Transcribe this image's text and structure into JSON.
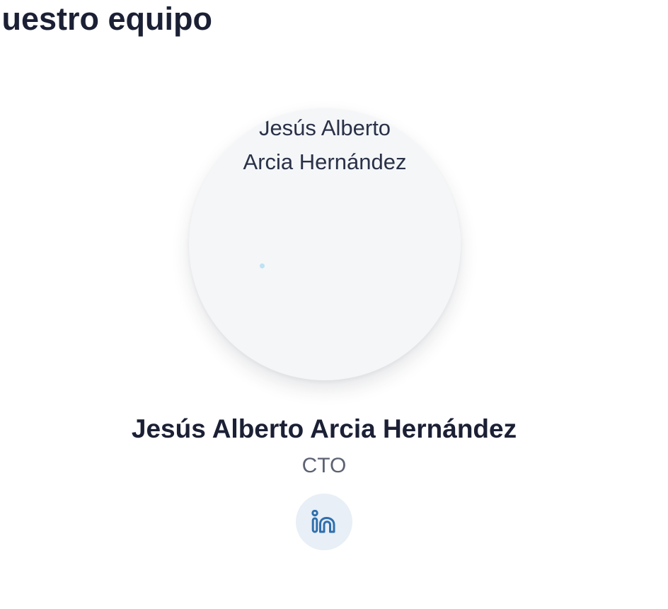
{
  "section": {
    "title": "Nuestro equipo"
  },
  "member": {
    "photo_alt": "Jesús Alberto Arcia Hernández",
    "name": "Jesús Alberto Arcia Hernández",
    "role": "CTO",
    "social": {
      "icon": "linkedin-icon",
      "label": "LinkedIn"
    }
  },
  "colors": {
    "text_primary": "#1b2035",
    "text_secondary": "#5c6272",
    "photo_background": "#f4f6f8",
    "social_background": "#e8eff6",
    "linkedin_blue": "#2f6fae"
  }
}
